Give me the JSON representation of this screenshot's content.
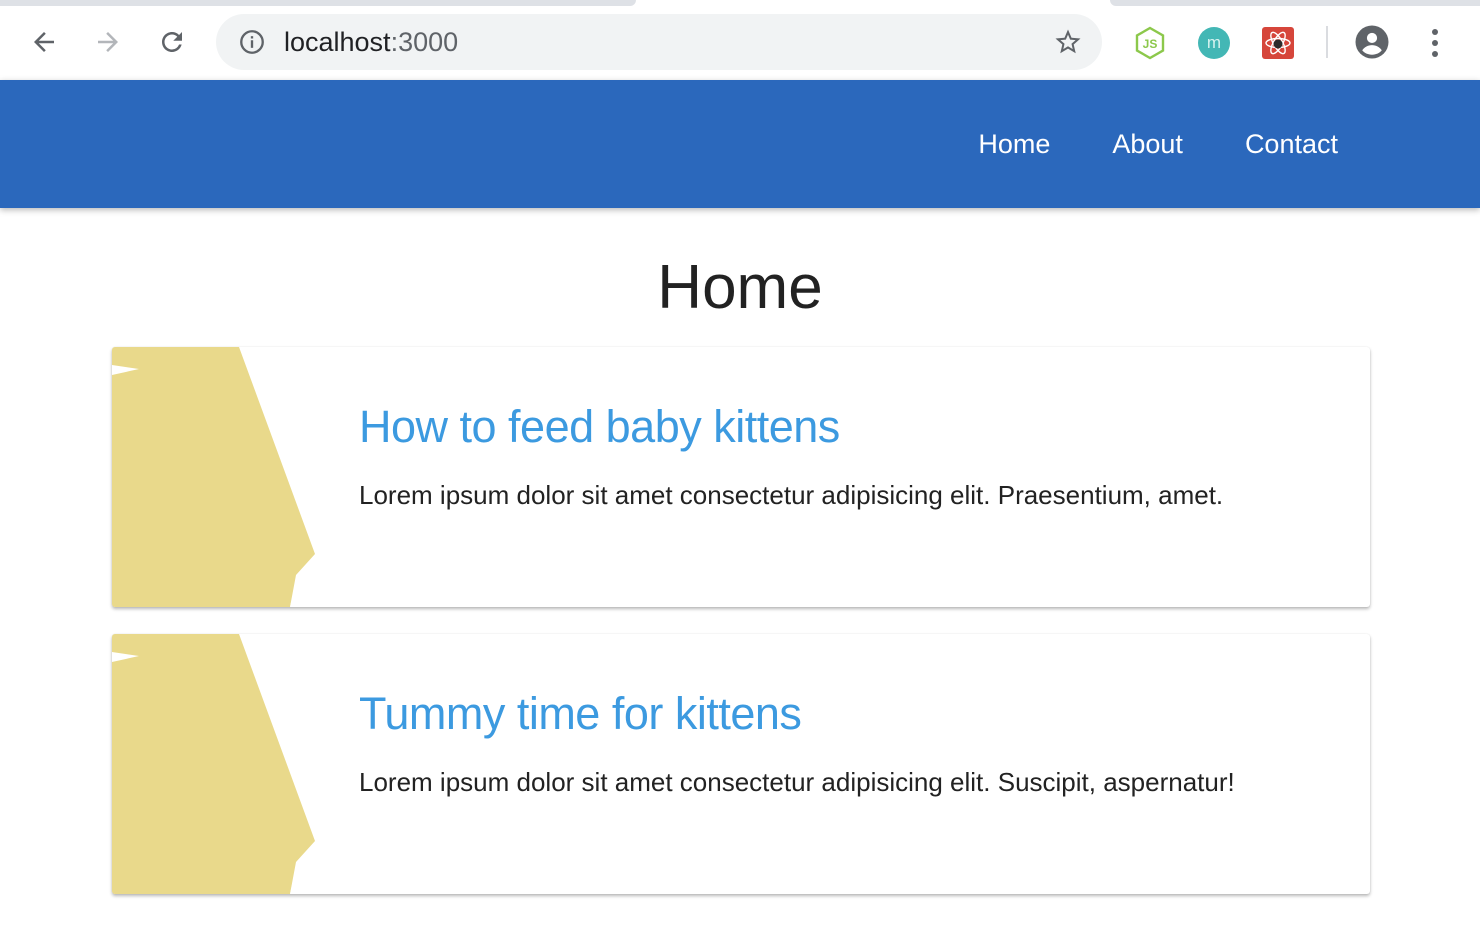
{
  "browser": {
    "url_host": "localhost",
    "url_port": ":3000",
    "toolbar_icons": [
      "back-arrow-icon",
      "forward-arrow-icon",
      "reload-icon",
      "site-info-icon",
      "bookmark-star-icon"
    ],
    "extensions": [
      {
        "name": "nodejs-extension-icon",
        "color": "#8cc84b"
      },
      {
        "name": "m-extension-icon",
        "color": "#43b7b5",
        "label": "m"
      },
      {
        "name": "react-devtools-extension-icon",
        "color": "#d6463b"
      }
    ],
    "menu_icons": [
      "profile-icon",
      "more-menu-icon"
    ]
  },
  "navbar": {
    "background": "#2b68bc",
    "links": [
      "Home",
      "About",
      "Contact"
    ]
  },
  "page": {
    "title": "Home"
  },
  "posts": [
    {
      "title": "How to feed baby kittens",
      "body": "Lorem ipsum dolor sit amet consectetur adipisicing elit. Praesentium, amet."
    },
    {
      "title": "Tummy time for kittens",
      "body": "Lorem ipsum dolor sit amet consectetur adipisicing elit. Suscipit, aspernatur!"
    }
  ],
  "colors": {
    "card_title": "#3c9ae0",
    "image_fill": "#e9d98b"
  }
}
